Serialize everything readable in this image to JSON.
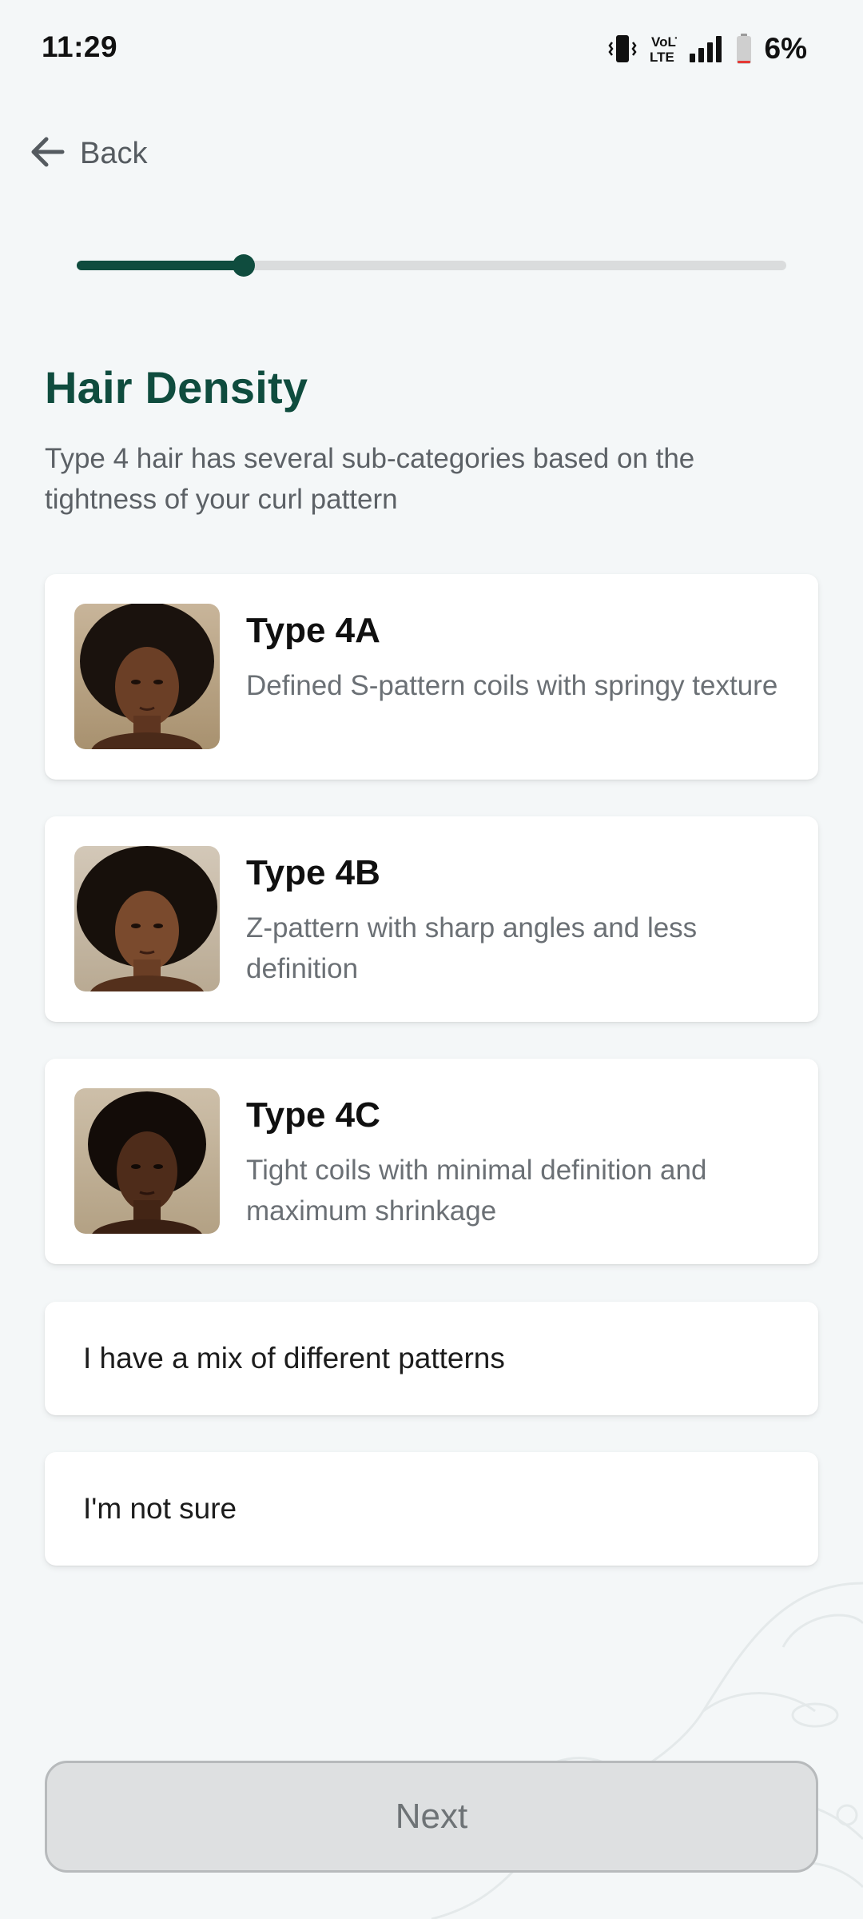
{
  "status_bar": {
    "time": "11:29",
    "battery": "6%",
    "network": "VoLTE",
    "network_sub": "LTE"
  },
  "nav": {
    "back_label": "Back"
  },
  "progress": {
    "fraction": 0.235,
    "color": "#0F4C3E"
  },
  "header": {
    "title": "Hair Density",
    "subtitle": "Type 4 hair has several sub-categories based on the tightness of your curl pattern"
  },
  "options": [
    {
      "title": "Type 4A",
      "description": "Defined S-pattern coils with springy texture",
      "image": "portrait-type-4a"
    },
    {
      "title": "Type 4B",
      "description": "Z-pattern with sharp angles and less definition",
      "image": "portrait-type-4b"
    },
    {
      "title": "Type 4C",
      "description": "Tight coils with minimal definition and maximum shrinkage",
      "image": "portrait-type-4c"
    }
  ],
  "extra_options": [
    {
      "label": "I have a mix of different patterns"
    },
    {
      "label": "I'm not sure"
    }
  ],
  "next_button": {
    "label": "Next",
    "enabled": false
  },
  "colors": {
    "accent": "#0F4C3E",
    "background": "#F4F7F8",
    "card": "#FFFFFF"
  }
}
